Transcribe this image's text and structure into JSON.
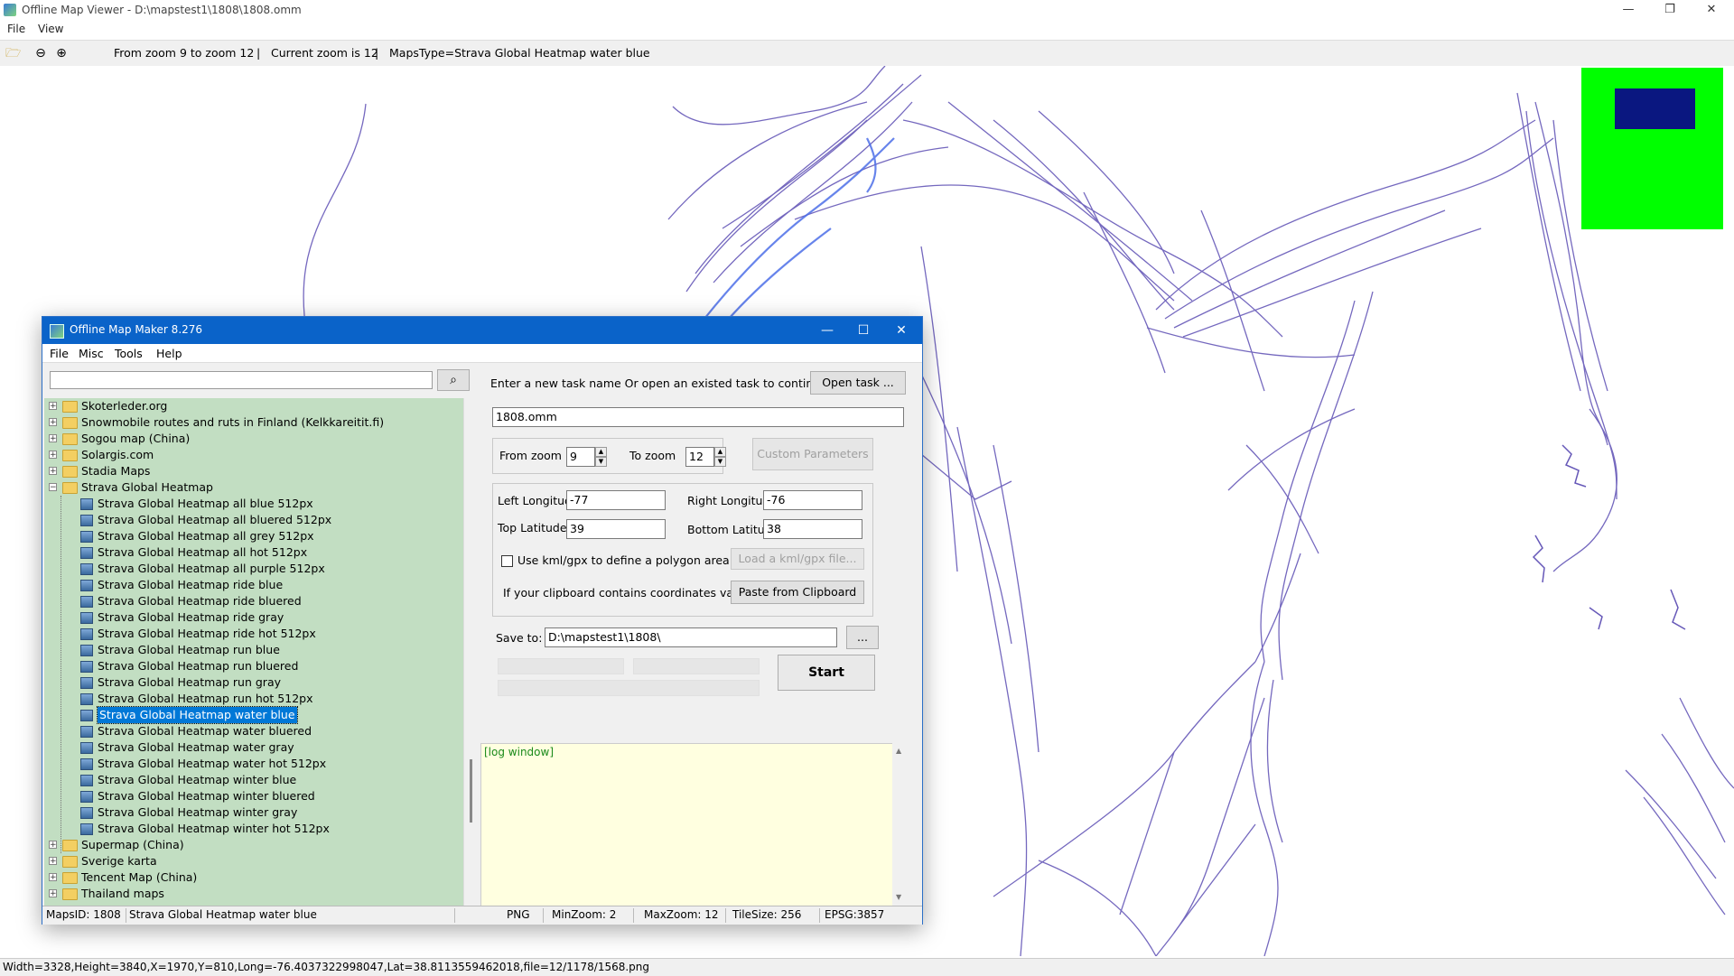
{
  "window": {
    "title": "Offline Map Viewer - D:\\mapstest1\\1808\\1808.omm",
    "controls": {
      "minimize": "—",
      "maximize": "❐",
      "close": "✕"
    }
  },
  "menu": {
    "file": "File",
    "view": "View"
  },
  "toolbar": {
    "zoom_range": "From zoom 9 to zoom 12",
    "current_zoom": "Current zoom is 12",
    "maps_type": "MapsType=Strava Global Heatmap water blue",
    "sep": "|"
  },
  "statusbar": {
    "text": "Width=3328,Height=3840,X=1970,Y=810,Long=-76.4037322998047,Lat=38.8113559462018,file=12/1178/1568.png"
  },
  "colors": {
    "track": "#6658b8",
    "overview_bg": "#00ff00",
    "overview_rect": "#0a1780",
    "tree_bg": "#c2dec2",
    "titlebar": "#0a63c9"
  },
  "dialog": {
    "title": "Offline Map Maker 8.276",
    "controls": {
      "minimize": "—",
      "maximize": "☐",
      "close": "✕"
    },
    "menu": {
      "file": "File",
      "misc": "Misc",
      "tools": "Tools",
      "help": "Help"
    },
    "search": {
      "value": "",
      "icon": "search-icon"
    },
    "tree": {
      "top_folders": [
        "Skoterleder.org",
        "Snowmobile routes and ruts in Finland (Kelkkareitit.fi)",
        "Sogou map (China)",
        "Solargis.com",
        "Stadia Maps"
      ],
      "open_folder": "Strava Global Heatmap",
      "children": [
        "Strava Global Heatmap all blue 512px",
        "Strava Global Heatmap all bluered 512px",
        "Strava Global Heatmap all grey 512px",
        "Strava Global Heatmap all hot 512px",
        "Strava Global Heatmap all purple 512px",
        "Strava Global Heatmap ride blue",
        "Strava Global Heatmap ride bluered",
        "Strava Global Heatmap ride gray",
        "Strava Global Heatmap ride hot 512px",
        "Strava Global Heatmap run blue",
        "Strava Global Heatmap run bluered",
        "Strava Global Heatmap run gray",
        "Strava Global Heatmap run hot 512px",
        "Strava Global Heatmap water blue",
        "Strava Global Heatmap water bluered",
        "Strava Global Heatmap water gray",
        "Strava Global Heatmap water hot 512px",
        "Strava Global Heatmap winter blue",
        "Strava Global Heatmap winter bluered",
        "Strava Global Heatmap winter gray",
        "Strava Global Heatmap winter hot 512px"
      ],
      "selected": "Strava Global Heatmap water blue",
      "bottom_folders": [
        "Supermap (China)",
        "Sverige karta",
        "Tencent Map (China)",
        "Thailand maps"
      ]
    },
    "task": {
      "prompt": "Enter a new task name Or open an existed task to continue:",
      "open_button": "Open task ...",
      "name_value": "1808.omm"
    },
    "zoom": {
      "from_label": "From zoom",
      "from_value": "9",
      "to_label": "To zoom",
      "to_value": "12",
      "custom_button": "Custom Parameters"
    },
    "coords": {
      "left_lon_label": "Left Longitude",
      "left_lon_value": "-77",
      "right_lon_label": "Right Longitude",
      "right_lon_value": "-76",
      "top_lat_label": "Top Latitude",
      "top_lat_value": "39",
      "bottom_lat_label": "Bottom Latitude",
      "bottom_lat_value": "38",
      "kml_checkbox_label": "Use kml/gpx to define a polygon area",
      "kml_button": "Load a kml/gpx file...",
      "clipboard_label": "If your clipboard contains coordinates values:",
      "clipboard_button": "Paste from Clipboard"
    },
    "save": {
      "label": "Save to:",
      "value": "D:\\mapstest1\\1808\\",
      "browse_button": "..."
    },
    "start_button": "Start",
    "log": {
      "text": "[log window]"
    },
    "status": {
      "maps_id": "MapsID: 1808",
      "name": "Strava Global Heatmap water blue",
      "format": "PNG",
      "min_zoom": "MinZoom: 2",
      "max_zoom": "MaxZoom: 12",
      "tile_size": "TileSize: 256",
      "epsg": "EPSG:3857"
    }
  }
}
